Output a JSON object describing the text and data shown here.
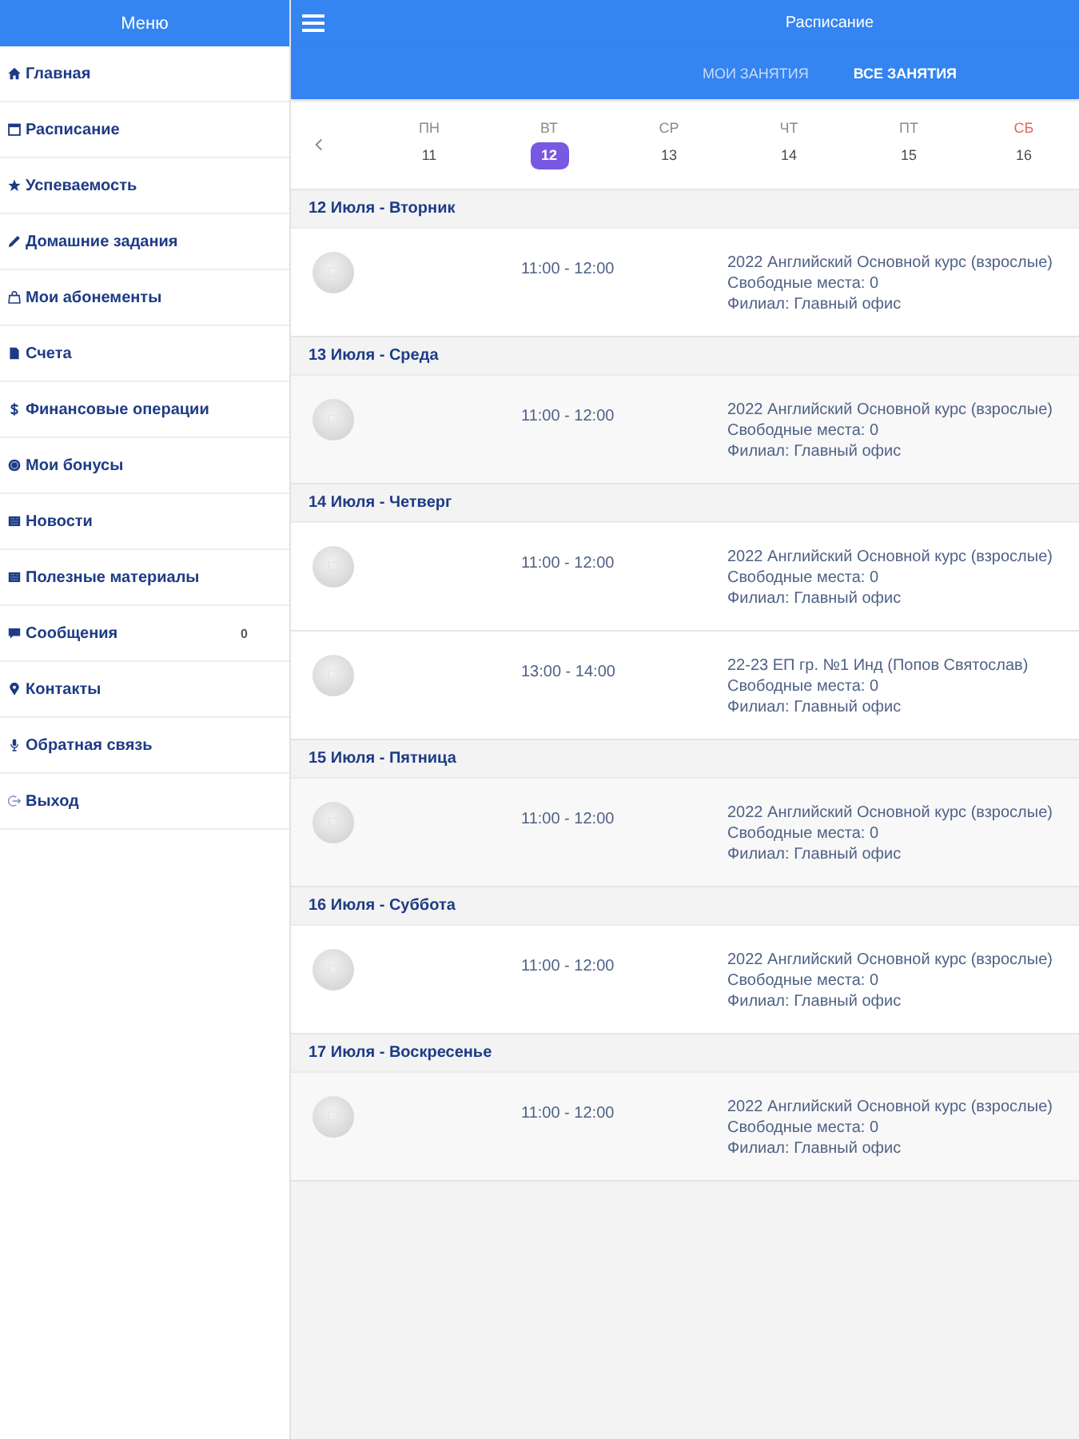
{
  "sidebar": {
    "title": "Меню",
    "items": [
      {
        "label": "Главная"
      },
      {
        "label": "Расписание"
      },
      {
        "label": "Успеваемость"
      },
      {
        "label": "Домашние задания"
      },
      {
        "label": "Мои абонементы"
      },
      {
        "label": "Счета"
      },
      {
        "label": "Финансовые операции"
      },
      {
        "label": "Мои бонусы"
      },
      {
        "label": "Новости"
      },
      {
        "label": "Полезные материалы"
      },
      {
        "label": "Сообщения",
        "badge": "0"
      },
      {
        "label": "Контакты"
      },
      {
        "label": "Обратная связь"
      },
      {
        "label": "Выход"
      }
    ]
  },
  "header": {
    "title": "Расписание"
  },
  "tabs": [
    {
      "label": "МОИ ЗАНЯТИЯ",
      "selected": false
    },
    {
      "label": "ВСЕ ЗАНЯТИЯ",
      "selected": true
    }
  ],
  "week": {
    "days": [
      {
        "weekday": "ПН",
        "date": "11",
        "selected": false,
        "weekend": false
      },
      {
        "weekday": "ВТ",
        "date": "12",
        "selected": true,
        "weekend": false
      },
      {
        "weekday": "СР",
        "date": "13",
        "selected": false,
        "weekend": false
      },
      {
        "weekday": "ЧТ",
        "date": "14",
        "selected": false,
        "weekend": false
      },
      {
        "weekday": "ПТ",
        "date": "15",
        "selected": false,
        "weekend": false
      },
      {
        "weekday": "СБ",
        "date": "16",
        "selected": false,
        "weekend": true
      }
    ]
  },
  "schedule": [
    {
      "heading": "12 Июля - Вторник",
      "lessons": [
        {
          "time": "11:00 - 12:00",
          "title": "2022 Английский Основной курс (взрослые)",
          "seats": "Свободные места: 0",
          "branch": "Филиал: Главный офис"
        }
      ]
    },
    {
      "heading": "13 Июля - Среда",
      "lessons": [
        {
          "time": "11:00 - 12:00",
          "title": "2022 Английский Основной курс (взрослые)",
          "seats": "Свободные места: 0",
          "branch": "Филиал: Главный офис"
        }
      ]
    },
    {
      "heading": "14 Июля - Четверг",
      "lessons": [
        {
          "time": "11:00 - 12:00",
          "title": "2022 Английский Основной курс (взрослые)",
          "seats": "Свободные места: 0",
          "branch": "Филиал: Главный офис"
        },
        {
          "time": "13:00 - 14:00",
          "title": "22-23 ЕП гр. №1 Инд (Попов Святослав)",
          "seats": "Свободные места: 0",
          "branch": "Филиал: Главный офис"
        }
      ]
    },
    {
      "heading": "15 Июля - Пятница",
      "lessons": [
        {
          "time": "11:00 - 12:00",
          "title": "2022 Английский Основной курс (взрослые)",
          "seats": "Свободные места: 0",
          "branch": "Филиал: Главный офис"
        }
      ]
    },
    {
      "heading": "16 Июля - Суббота",
      "lessons": [
        {
          "time": "11:00 - 12:00",
          "title": "2022 Английский Основной курс (взрослые)",
          "seats": "Свободные места: 0",
          "branch": "Филиал: Главный офис"
        }
      ]
    },
    {
      "heading": "17 Июля - Воскресенье",
      "lessons": [
        {
          "time": "11:00 - 12:00",
          "title": "2022 Английский Основной курс (взрослые)",
          "seats": "Свободные места: 0",
          "branch": "Филиал: Главный офис"
        }
      ]
    }
  ]
}
